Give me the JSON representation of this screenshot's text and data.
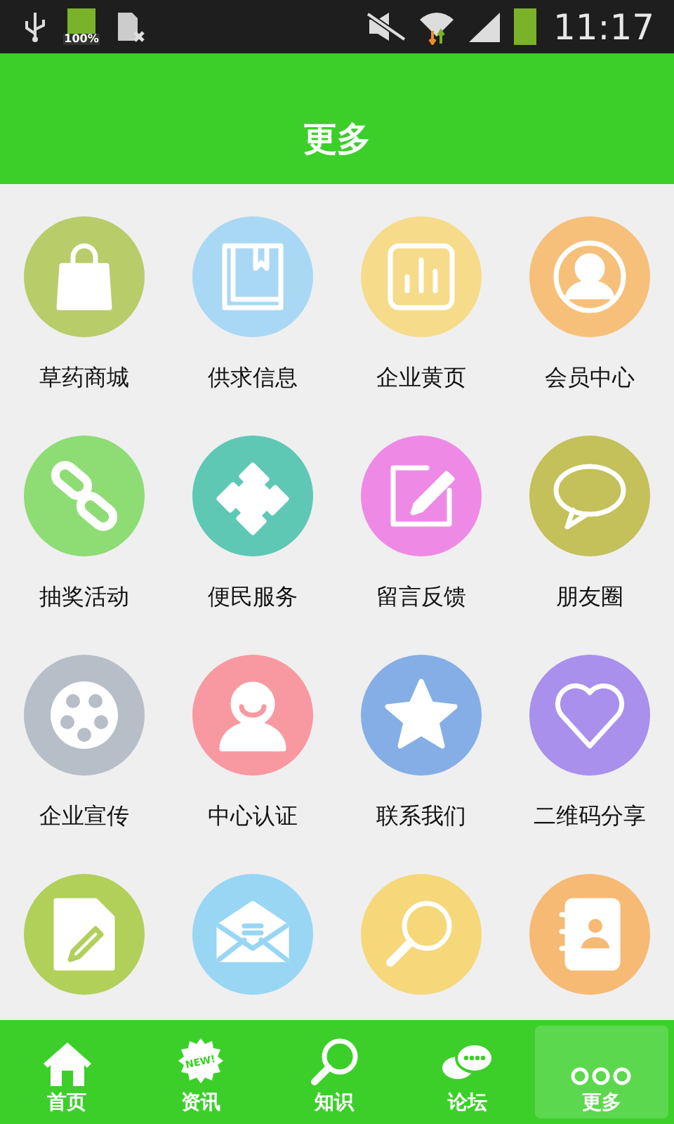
{
  "status_bar": {
    "battery_text": "100%",
    "time": "11:17"
  },
  "header": {
    "title": "更多"
  },
  "grid": [
    {
      "label": "草药商城",
      "kind": "bag",
      "color": "#b8cc6a"
    },
    {
      "label": "供求信息",
      "kind": "book",
      "color": "#a8d8f4"
    },
    {
      "label": "企业黄页",
      "kind": "chart",
      "color": "#f6dc8a"
    },
    {
      "label": "会员中心",
      "kind": "person",
      "color": "#f6c07a"
    },
    {
      "label": "抽奖活动",
      "kind": "link",
      "color": "#8edc74"
    },
    {
      "label": "便民服务",
      "kind": "puzzle",
      "color": "#5ec8b4"
    },
    {
      "label": "留言反馈",
      "kind": "note",
      "color": "#ee8ae6"
    },
    {
      "label": "朋友圈",
      "kind": "chat",
      "color": "#c4c05a"
    },
    {
      "label": "企业宣传",
      "kind": "film",
      "color": "#b8bec8"
    },
    {
      "label": "中心认证",
      "kind": "smile",
      "color": "#f898a0"
    },
    {
      "label": "联系我们",
      "kind": "star",
      "color": "#86aee6"
    },
    {
      "label": "二维码分享",
      "kind": "heart",
      "color": "#a890ec"
    },
    {
      "kind": "document",
      "color": "#b0d05a"
    },
    {
      "kind": "mail",
      "color": "#98d6f4"
    },
    {
      "kind": "search",
      "color": "#f6d87a"
    },
    {
      "kind": "contacts",
      "color": "#f6ba74"
    }
  ],
  "nav": [
    {
      "label": "首页",
      "kind": "home",
      "selected": false
    },
    {
      "label": "资讯",
      "kind": "news",
      "badge": "NEW!",
      "selected": false
    },
    {
      "label": "知识",
      "kind": "search",
      "selected": false
    },
    {
      "label": "论坛",
      "kind": "chat",
      "selected": false
    },
    {
      "label": "更多",
      "kind": "more",
      "selected": true
    }
  ]
}
